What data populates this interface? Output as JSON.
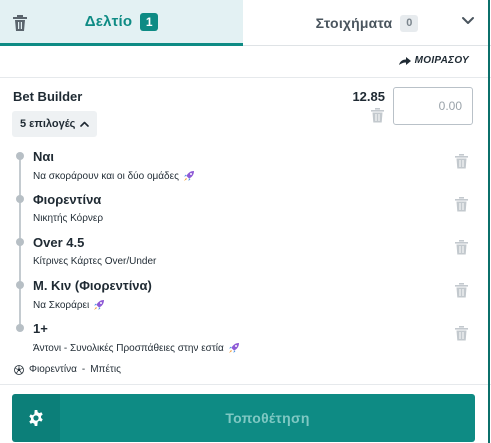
{
  "tabs": {
    "betslip_label": "Δελτίο",
    "betslip_count": "1",
    "bets_label": "Στοιχήματα",
    "bets_count": "0",
    "clear_icon": "trash-icon",
    "collapse_icon": "chevron-down-icon"
  },
  "share": {
    "label": "ΜΟΙΡΑΣΟΥ",
    "icon": "share-arrow-icon"
  },
  "bet_builder": {
    "title": "Bet Builder",
    "odds": "12.85",
    "stake_placeholder": "0.00",
    "selections_label": "5 επιλογές",
    "selections_icon": "chevron-up-icon"
  },
  "legs": [
    {
      "name": "Ναι",
      "market": "Να σκοράρουν και οι δύο ομάδες",
      "boost": true
    },
    {
      "name": "Φιορεντίνα",
      "market": "Νικητής Κόρνερ",
      "boost": false
    },
    {
      "name": "Over 4.5",
      "market": "Κίτρινες Κάρτες Over/Under",
      "boost": false
    },
    {
      "name": "Μ. Κιν (Φιορεντίνα)",
      "market": "Να Σκοράρει",
      "boost": true
    },
    {
      "name": "1+",
      "market": "Άντονι - Συνολικές Προσπάθειες στην εστία",
      "boost": true
    }
  ],
  "event": {
    "home": "Φιορεντίνα",
    "separator": "-",
    "away": "Μπέτις",
    "icon": "soccer-ball-icon"
  },
  "footer": {
    "place_label": "Τοποθέτηση",
    "settings_icon": "gear-icon"
  },
  "colors": {
    "accent": "#0e8b84",
    "accent_dark": "#0c7f79",
    "tab_active_bg": "#e3f1f3",
    "text": "#1f2a33"
  }
}
